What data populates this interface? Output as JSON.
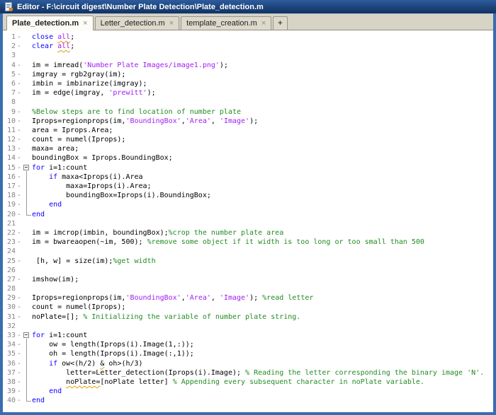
{
  "window": {
    "title": "Editor - F:\\circuit digest\\Number Plate Detection\\Plate_detection.m"
  },
  "tabs": [
    {
      "label": "Plate_detection.m",
      "active": true
    },
    {
      "label": "Letter_detection.m",
      "active": false
    },
    {
      "label": "template_creation.m",
      "active": false
    }
  ],
  "tab_close_glyph": "×",
  "new_tab_label": "+",
  "colors": {
    "keyword": "#0e00ff",
    "string": "#a020f0",
    "comment": "#228b22",
    "warning_underline": "#e8a000",
    "window_border": "#3a6cb0",
    "title_bar": "#1c4379",
    "tab_bar_background": "#d7d3c5",
    "line_number": "#848484"
  },
  "code": {
    "language": "matlab",
    "lines": [
      {
        "n": 1,
        "d": true,
        "f": "",
        "t": [
          [
            "k",
            "close"
          ],
          [
            "p",
            " "
          ],
          [
            "ws",
            "all"
          ],
          [
            "p",
            ";"
          ]
        ]
      },
      {
        "n": 2,
        "d": true,
        "f": "",
        "t": [
          [
            "k",
            "clear"
          ],
          [
            "p",
            " "
          ],
          [
            "ws",
            "all"
          ],
          [
            "p",
            ";"
          ]
        ]
      },
      {
        "n": 3,
        "d": false,
        "f": "",
        "t": []
      },
      {
        "n": 4,
        "d": true,
        "f": "",
        "t": [
          [
            "p",
            "im = imread("
          ],
          [
            "s",
            "'Number Plate Images/image1.png'"
          ],
          [
            "p",
            ");"
          ]
        ]
      },
      {
        "n": 5,
        "d": true,
        "f": "",
        "t": [
          [
            "p",
            "imgray = rgb2gray(im);"
          ]
        ]
      },
      {
        "n": 6,
        "d": true,
        "f": "",
        "t": [
          [
            "p",
            "imbin = imbinarize(imgray);"
          ]
        ]
      },
      {
        "n": 7,
        "d": true,
        "f": "",
        "t": [
          [
            "p",
            "im = edge(imgray, "
          ],
          [
            "s",
            "'prewitt'"
          ],
          [
            "p",
            ");"
          ]
        ]
      },
      {
        "n": 8,
        "d": false,
        "f": "",
        "t": []
      },
      {
        "n": 9,
        "d": true,
        "f": "",
        "t": [
          [
            "c",
            "%Below steps are to find location of number plate"
          ]
        ]
      },
      {
        "n": 10,
        "d": true,
        "f": "",
        "t": [
          [
            "p",
            "Iprops=regionprops(im,"
          ],
          [
            "s",
            "'BoundingBox'"
          ],
          [
            "p",
            ","
          ],
          [
            "s",
            "'Area'"
          ],
          [
            "p",
            ", "
          ],
          [
            "s",
            "'Image'"
          ],
          [
            "p",
            ");"
          ]
        ]
      },
      {
        "n": 11,
        "d": true,
        "f": "",
        "t": [
          [
            "p",
            "area = Iprops.Area;"
          ]
        ]
      },
      {
        "n": 12,
        "d": true,
        "f": "",
        "t": [
          [
            "p",
            "count = numel(Iprops);"
          ]
        ]
      },
      {
        "n": 13,
        "d": true,
        "f": "",
        "t": [
          [
            "p",
            "maxa= area;"
          ]
        ]
      },
      {
        "n": 14,
        "d": true,
        "f": "",
        "t": [
          [
            "p",
            "boundingBox = Iprops.BoundingBox;"
          ]
        ]
      },
      {
        "n": 15,
        "d": true,
        "f": "start",
        "t": [
          [
            "k",
            "for"
          ],
          [
            "p",
            " i=1:count"
          ]
        ]
      },
      {
        "n": 16,
        "d": true,
        "f": "mid",
        "t": [
          [
            "p",
            "    "
          ],
          [
            "k",
            "if"
          ],
          [
            "p",
            " maxa<Iprops(i).Area"
          ]
        ]
      },
      {
        "n": 17,
        "d": true,
        "f": "mid",
        "t": [
          [
            "p",
            "        maxa=Iprops(i).Area;"
          ]
        ]
      },
      {
        "n": 18,
        "d": true,
        "f": "mid",
        "t": [
          [
            "p",
            "        boundingBox=Iprops(i).BoundingBox;"
          ]
        ]
      },
      {
        "n": 19,
        "d": true,
        "f": "mid",
        "t": [
          [
            "p",
            "    "
          ],
          [
            "k",
            "end"
          ]
        ]
      },
      {
        "n": 20,
        "d": true,
        "f": "end",
        "t": [
          [
            "k",
            "end"
          ]
        ]
      },
      {
        "n": 21,
        "d": false,
        "f": "",
        "t": []
      },
      {
        "n": 22,
        "d": true,
        "f": "",
        "t": [
          [
            "p",
            "im = imcrop(imbin, boundingBox);"
          ],
          [
            "c",
            "%crop the number plate area"
          ]
        ]
      },
      {
        "n": 23,
        "d": true,
        "f": "",
        "t": [
          [
            "p",
            "im = bwareaopen(~im, 500); "
          ],
          [
            "c",
            "%remove some object if it width is too long or too small than 500"
          ]
        ]
      },
      {
        "n": 24,
        "d": false,
        "f": "",
        "t": []
      },
      {
        "n": 25,
        "d": true,
        "f": "",
        "t": [
          [
            "p",
            " [h, w] = size(im);"
          ],
          [
            "c",
            "%get width"
          ]
        ]
      },
      {
        "n": 26,
        "d": false,
        "f": "",
        "t": []
      },
      {
        "n": 27,
        "d": true,
        "f": "",
        "t": [
          [
            "p",
            "imshow(im);"
          ]
        ]
      },
      {
        "n": 28,
        "d": false,
        "f": "",
        "t": []
      },
      {
        "n": 29,
        "d": true,
        "f": "",
        "t": [
          [
            "p",
            "Iprops=regionprops(im,"
          ],
          [
            "s",
            "'BoundingBox'"
          ],
          [
            "p",
            ","
          ],
          [
            "s",
            "'Area'"
          ],
          [
            "p",
            ", "
          ],
          [
            "s",
            "'Image'"
          ],
          [
            "p",
            "); "
          ],
          [
            "c",
            "%read letter"
          ]
        ]
      },
      {
        "n": 30,
        "d": true,
        "f": "",
        "t": [
          [
            "p",
            "count = numel(Iprops);"
          ]
        ]
      },
      {
        "n": 31,
        "d": true,
        "f": "",
        "t": [
          [
            "p",
            "noPlate=[]; "
          ],
          [
            "c",
            "% Initializing the variable of number plate string."
          ]
        ]
      },
      {
        "n": 32,
        "d": false,
        "f": "",
        "t": []
      },
      {
        "n": 33,
        "d": true,
        "f": "start",
        "t": [
          [
            "k",
            "for"
          ],
          [
            "p",
            " i=1:count"
          ]
        ]
      },
      {
        "n": 34,
        "d": true,
        "f": "mid",
        "t": [
          [
            "p",
            "    ow = length(Iprops(i).Image(1,:));"
          ]
        ]
      },
      {
        "n": 35,
        "d": true,
        "f": "mid",
        "t": [
          [
            "p",
            "    oh = length(Iprops(i).Image(:,1));"
          ]
        ]
      },
      {
        "n": 36,
        "d": true,
        "f": "mid",
        "t": [
          [
            "p",
            "    "
          ],
          [
            "k",
            "if"
          ],
          [
            "p",
            " ow<(h/2) "
          ],
          [
            "wp",
            "&"
          ],
          [
            "p",
            " oh>(h/3)"
          ]
        ]
      },
      {
        "n": 37,
        "d": true,
        "f": "mid",
        "t": [
          [
            "p",
            "        letter=Letter_detection(Iprops(i).Image); "
          ],
          [
            "c",
            "% Reading the letter corresponding the binary image 'N'."
          ]
        ]
      },
      {
        "n": 38,
        "d": true,
        "f": "mid",
        "t": [
          [
            "p",
            "        "
          ],
          [
            "wp",
            "noPlate="
          ],
          [
            "p",
            "[noPlate letter] "
          ],
          [
            "c",
            "% Appending every subsequent character in noPlate variable."
          ]
        ]
      },
      {
        "n": 39,
        "d": true,
        "f": "mid",
        "t": [
          [
            "p",
            "    "
          ],
          [
            "k",
            "end"
          ]
        ]
      },
      {
        "n": 40,
        "d": true,
        "f": "end",
        "t": [
          [
            "k",
            "end"
          ]
        ]
      }
    ]
  }
}
